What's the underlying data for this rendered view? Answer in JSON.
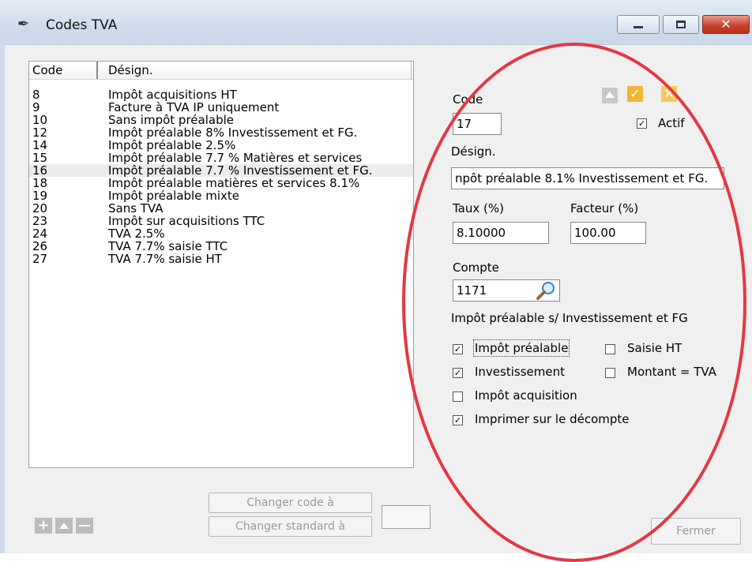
{
  "window": {
    "title": "Codes TVA",
    "app_icon": "pen-icon"
  },
  "titlebar_buttons": {
    "minimize_icon": "minimize-icon",
    "maximize_icon": "maximize-icon",
    "close_icon": "close-icon",
    "close_glyph": "✕"
  },
  "list": {
    "headers": {
      "code": "Code",
      "designation": "Désign."
    },
    "rows": [
      {
        "code": "8",
        "designation": "Impôt acquisitions HT"
      },
      {
        "code": "9",
        "designation": "Facture à TVA IP uniquement"
      },
      {
        "code": "10",
        "designation": "Sans impôt préalable"
      },
      {
        "code": "12",
        "designation": "Impôt préalable 8% Investissement et FG."
      },
      {
        "code": "14",
        "designation": "Impôt préalable 2.5%"
      },
      {
        "code": "15",
        "designation": "Impôt préalable 7.7 % Matières et services"
      },
      {
        "code": "16",
        "designation": "Impôt préalable 7.7 % Investissement et FG."
      },
      {
        "code": "18",
        "designation": "Impôt préalable matières et services 8.1%"
      },
      {
        "code": "19",
        "designation": "Impôt préalable mixte"
      },
      {
        "code": "20",
        "designation": "Sans TVA"
      },
      {
        "code": "23",
        "designation": "Impôt sur acquisitions TTC"
      },
      {
        "code": "24",
        "designation": "TVA 2.5%"
      },
      {
        "code": "26",
        "designation": "TVA  7.7% saisie TTC"
      },
      {
        "code": "27",
        "designation": "TVA  7.7% saisie HT"
      }
    ],
    "selected_code": "16"
  },
  "detail": {
    "code_label": "Code",
    "code_value": "17",
    "actif_label": "Actif",
    "actif_checked": true,
    "desig_label": "Désign.",
    "desig_value": "npôt préalable 8.1% Investissement et FG.",
    "taux_label": "Taux (%)",
    "taux_value": "8.10000",
    "facteur_label": "Facteur (%)",
    "facteur_value": "100.00",
    "compte_label": "Compte",
    "compte_value": "1171",
    "compte_search_icon": "magnifier-icon",
    "compte_description": "Impôt préalable s/ Investissement et FG",
    "options": [
      {
        "label": "Impôt préalable",
        "checked": true
      },
      {
        "label": "Investissement",
        "checked": true
      },
      {
        "label": "Impôt acquisition",
        "checked": false
      },
      {
        "label": "Imprimer sur le décompte",
        "checked": true
      },
      {
        "label": "Saisie HT",
        "checked": false
      },
      {
        "label": "Montant = TVA",
        "checked": false
      }
    ],
    "check_glyph": "✓",
    "action_icons": {
      "move_up": "arrow-up-icon",
      "confirm": "checkmark-icon",
      "cancel": "cancel-icon",
      "confirm_glyph": "✓",
      "cancel_glyph": "✕"
    }
  },
  "bottom": {
    "changer_code_label": "Changer code à",
    "changer_standard_label": "Changer standard à",
    "fermer_label": "Fermer",
    "add_icon": "plus-icon",
    "up_icon": "arrow-up-icon",
    "remove_icon": "minus-icon",
    "add_glyph": "+"
  },
  "colors": {
    "annotation_ring": "#e53744",
    "titlebar": "#cfdcec",
    "confirm": "#f2b536",
    "selected_row": "#ececec"
  }
}
